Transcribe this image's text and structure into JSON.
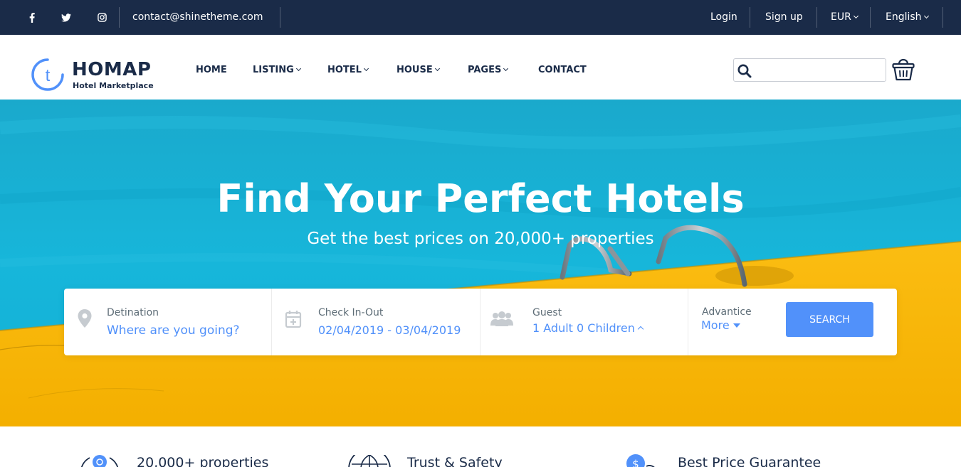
{
  "topbar": {
    "social": [
      {
        "name": "facebook-icon",
        "glyph": "f"
      },
      {
        "name": "twitter-icon",
        "glyph": "t"
      },
      {
        "name": "instagram-icon",
        "glyph": "ig"
      }
    ],
    "email": "contact@shinetheme.com",
    "login": "Login",
    "signup": "Sign up",
    "currency": "EUR",
    "language": "English"
  },
  "header": {
    "logo_name": "HOMAP",
    "logo_tagline": "Hotel Marketplace",
    "logo_letter": "t",
    "nav": [
      "HOME",
      "LISTING",
      "HOTEL",
      "HOUSE",
      "PAGES",
      "CONTACT"
    ],
    "search_placeholder": "",
    "search_value": ""
  },
  "hero": {
    "title": "Find Your Perfect Hotels",
    "subtitle": "Get the best prices on 20,000+ properties"
  },
  "search_form": {
    "destination": {
      "label": "Detination",
      "value": "Where are you going?",
      "icon": "map-pin-icon"
    },
    "checkin": {
      "label": "Check In-Out",
      "value": "02/04/2019 - 03/04/2019",
      "icon": "calendar-plus-icon"
    },
    "guest": {
      "label": "Guest",
      "value": "1 Adult 0 Children",
      "icon": "users-icon"
    },
    "advanced": {
      "label": "Advantice",
      "value": "More"
    },
    "button": "SEARCH"
  },
  "features": [
    {
      "title": "20,000+ properties",
      "icon": "globe-pin-icon"
    },
    {
      "title": "Trust & Safety",
      "icon": "globe-icon"
    },
    {
      "title": "Best Price Guarantee",
      "icon": "dollar-badge-icon"
    }
  ],
  "colors": {
    "topbar_bg": "#1a2b48",
    "accent": "#5191fa",
    "text_dark": "#1a2b48",
    "water": "#14b3d5",
    "deck": "#f7b500"
  }
}
